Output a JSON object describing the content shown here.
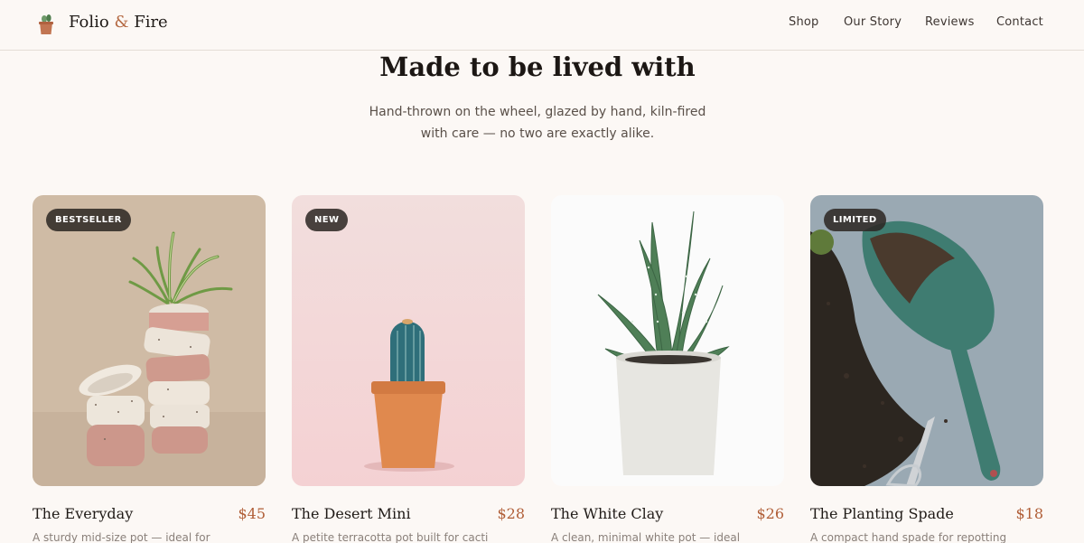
{
  "header": {
    "logo_icon": "potted-plant-icon",
    "brand_name": "Folio",
    "brand_amp": "&",
    "brand_suffix": "Fire",
    "brand_accent": "#b56a44",
    "nav": [
      "Shop",
      "Our Story",
      "Reviews",
      "Contact"
    ]
  },
  "hero": {
    "title": "Made to be lived with",
    "subtitle": "Hand-thrown on the wheel, glazed by hand, kiln-fired with care — no two are exactly alike."
  },
  "products": [
    {
      "badge": "BESTSELLER",
      "name": "The Everyday",
      "price": "$45",
      "description": "A sturdy mid-size pot — ideal for",
      "image": "stacked-speckled-pots-with-spider-plant"
    },
    {
      "badge": "NEW",
      "name": "The Desert Mini",
      "price": "$28",
      "description": "A petite terracotta pot built for cacti",
      "image": "cactus-in-terracotta-pot"
    },
    {
      "badge": "",
      "name": "The White Clay",
      "price": "$26",
      "description": "A clean, minimal white pot — ideal",
      "image": "aloe-in-white-concrete-pot"
    },
    {
      "badge": "LIMITED",
      "name": "The Planting Spade",
      "price": "$18",
      "description": "A compact hand spade for repotting",
      "image": "green-spade-with-soil"
    }
  ],
  "colors": {
    "background": "#fcf8f5",
    "price": "#b05e37",
    "badge": "#2c2623"
  }
}
